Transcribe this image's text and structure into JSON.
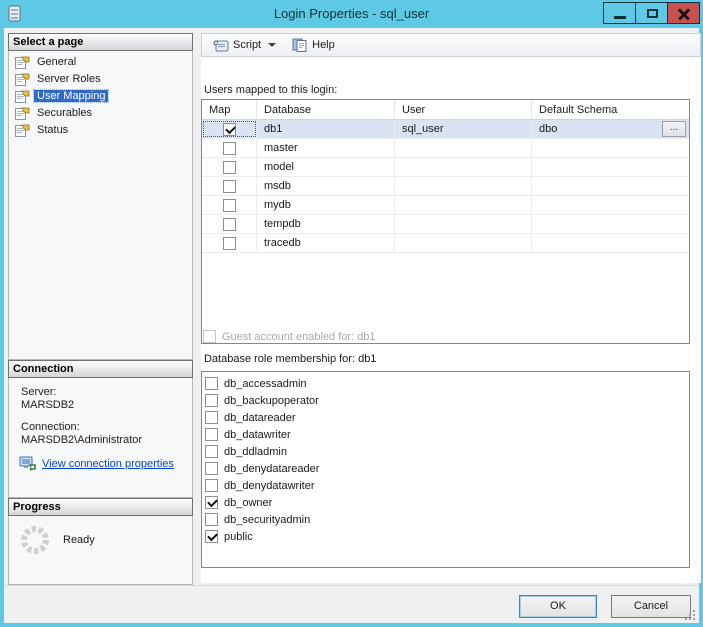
{
  "window": {
    "title": "Login Properties - sql_user"
  },
  "icons": {
    "window_icon": "form-properties",
    "minimize": "minimize-bar",
    "maximize": "square-outline",
    "close": "x-cross",
    "page_item": "property-page",
    "script": "scroll",
    "help": "book-pages",
    "connection_properties": "monitor-network",
    "progress_spinner": "segmented-ring",
    "ellipsis": "..."
  },
  "sidebar": {
    "select_page": {
      "header": "Select a page",
      "items": [
        {
          "label": "General",
          "selected": false
        },
        {
          "label": "Server Roles",
          "selected": false
        },
        {
          "label": "User Mapping",
          "selected": true
        },
        {
          "label": "Securables",
          "selected": false
        },
        {
          "label": "Status",
          "selected": false
        }
      ]
    },
    "connection": {
      "header": "Connection",
      "server_label": "Server:",
      "server_value": "MARSDB2",
      "connection_label": "Connection:",
      "connection_value": "MARSDB2\\Administrator",
      "link_label": "View connection properties"
    },
    "progress": {
      "header": "Progress",
      "status": "Ready"
    }
  },
  "toolbar": {
    "script_label": "Script",
    "help_label": "Help"
  },
  "main": {
    "users_mapped_label": "Users mapped to this login:",
    "table": {
      "columns": [
        "Map",
        "Database",
        "User",
        "Default Schema"
      ],
      "rows": [
        {
          "map": true,
          "database": "db1",
          "user": "sql_user",
          "default_schema": "dbo",
          "selected": true,
          "ellipsis": "..."
        },
        {
          "map": false,
          "database": "master",
          "user": "",
          "default_schema": "",
          "selected": false
        },
        {
          "map": false,
          "database": "model",
          "user": "",
          "default_schema": "",
          "selected": false
        },
        {
          "map": false,
          "database": "msdb",
          "user": "",
          "default_schema": "",
          "selected": false
        },
        {
          "map": false,
          "database": "mydb",
          "user": "",
          "default_schema": "",
          "selected": false
        },
        {
          "map": false,
          "database": "tempdb",
          "user": "",
          "default_schema": "",
          "selected": false
        },
        {
          "map": false,
          "database": "tracedb",
          "user": "",
          "default_schema": "",
          "selected": false
        }
      ]
    },
    "guest_label": "Guest account enabled for: db1",
    "roles_label": "Database role membership for: db1",
    "roles": [
      {
        "name": "db_accessadmin",
        "checked": false
      },
      {
        "name": "db_backupoperator",
        "checked": false
      },
      {
        "name": "db_datareader",
        "checked": false
      },
      {
        "name": "db_datawriter",
        "checked": false
      },
      {
        "name": "db_ddladmin",
        "checked": false
      },
      {
        "name": "db_denydatareader",
        "checked": false
      },
      {
        "name": "db_denydatawriter",
        "checked": false
      },
      {
        "name": "db_owner",
        "checked": true
      },
      {
        "name": "db_securityadmin",
        "checked": false
      },
      {
        "name": "public",
        "checked": true
      }
    ]
  },
  "footer": {
    "ok_label": "OK",
    "cancel_label": "Cancel"
  },
  "colors": {
    "titlebar": "#5ec9e5",
    "close_button": "#c75050",
    "selection_blue": "#316ac5",
    "selected_row": "#d9e3f1",
    "link_blue": "#0645c8",
    "dialog_bg": "#eef0f1"
  }
}
